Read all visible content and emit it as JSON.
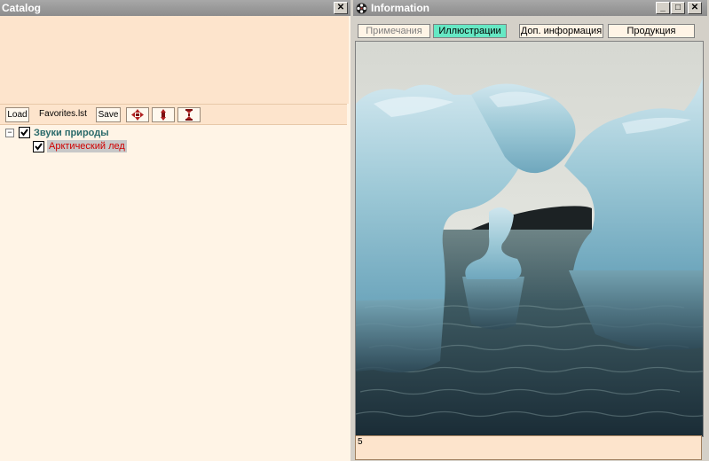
{
  "catalog": {
    "title": "Catalog",
    "close_glyph": "✕",
    "toolbar": {
      "load_label": "Load",
      "file_name": "Favorites.lst",
      "save_label": "Save",
      "move_all_icon": "move-all-icon",
      "move_up_icon": "move-up-icon",
      "move_down_icon": "move-down-icon"
    },
    "tree": [
      {
        "label": "Звуки природы",
        "expander": "−",
        "checked": true,
        "level": 0,
        "color": "#2a6a6a"
      },
      {
        "label": "Арктический лед",
        "checked": true,
        "level": 1,
        "color": "#d00000",
        "selected": true
      }
    ]
  },
  "info": {
    "title": "Information",
    "app_icon": "film-reel-icon",
    "window_buttons": {
      "minimize": "_",
      "maximize": "□",
      "close": "✕"
    },
    "tabs": [
      {
        "label": "Примечания",
        "state": "disabled"
      },
      {
        "label": "Иллюстрации",
        "state": "active"
      },
      {
        "label": "Доп. информация",
        "state": "normal"
      },
      {
        "label": "Продукция",
        "state": "normal"
      }
    ],
    "image": {
      "subject": "iceberg-arch-photo"
    },
    "status_text": "5"
  },
  "colors": {
    "panel_bg": "#fff4e6",
    "panel_header": "#fde4cc",
    "active_tab": "#66e8c4",
    "titlebar": "#8c8c8c",
    "tree_root_text": "#2a6a6a",
    "tree_child_text": "#d00000"
  }
}
